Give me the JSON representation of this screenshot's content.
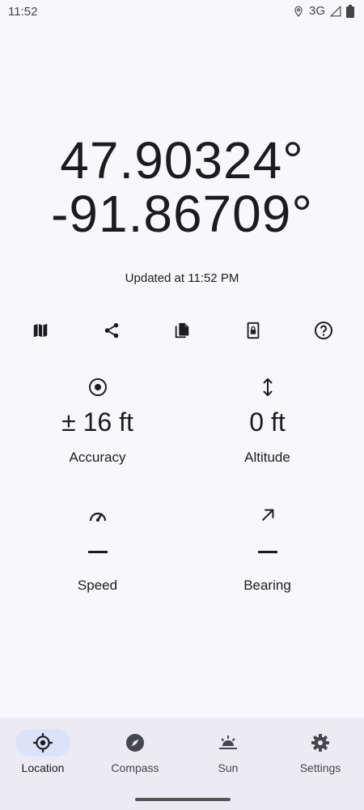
{
  "status_bar": {
    "time": "11:52",
    "network": "3G",
    "icons": [
      "location-icon",
      "signal-icon",
      "battery-icon"
    ]
  },
  "location": {
    "latitude": "47.90324°",
    "longitude": "-91.86709°",
    "updated": "Updated at 11:52 PM"
  },
  "actions": [
    {
      "icon": "map-icon"
    },
    {
      "icon": "share-icon"
    },
    {
      "icon": "copy-icon"
    },
    {
      "icon": "lock-screen-icon"
    },
    {
      "icon": "help-icon"
    }
  ],
  "stats": {
    "accuracy": {
      "value": "± 16 ft",
      "label": "Accuracy",
      "icon": "target-icon"
    },
    "altitude": {
      "value": "0 ft",
      "label": "Altitude",
      "icon": "vertical-arrows-icon"
    },
    "speed": {
      "value": "",
      "label": "Speed",
      "icon": "speedometer-icon"
    },
    "bearing": {
      "value": "",
      "label": "Bearing",
      "icon": "arrow-up-right-icon"
    }
  },
  "nav": {
    "items": [
      {
        "label": "Location",
        "icon": "crosshair-icon",
        "active": true
      },
      {
        "label": "Compass",
        "icon": "compass-icon",
        "active": false
      },
      {
        "label": "Sun",
        "icon": "sunrise-icon",
        "active": false
      },
      {
        "label": "Settings",
        "icon": "gear-icon",
        "active": false
      }
    ]
  },
  "colors": {
    "background": "#f8f7fc",
    "nav_background": "#ecebf3",
    "active_pill": "#dbe3fb",
    "text": "#1c1b1f"
  }
}
